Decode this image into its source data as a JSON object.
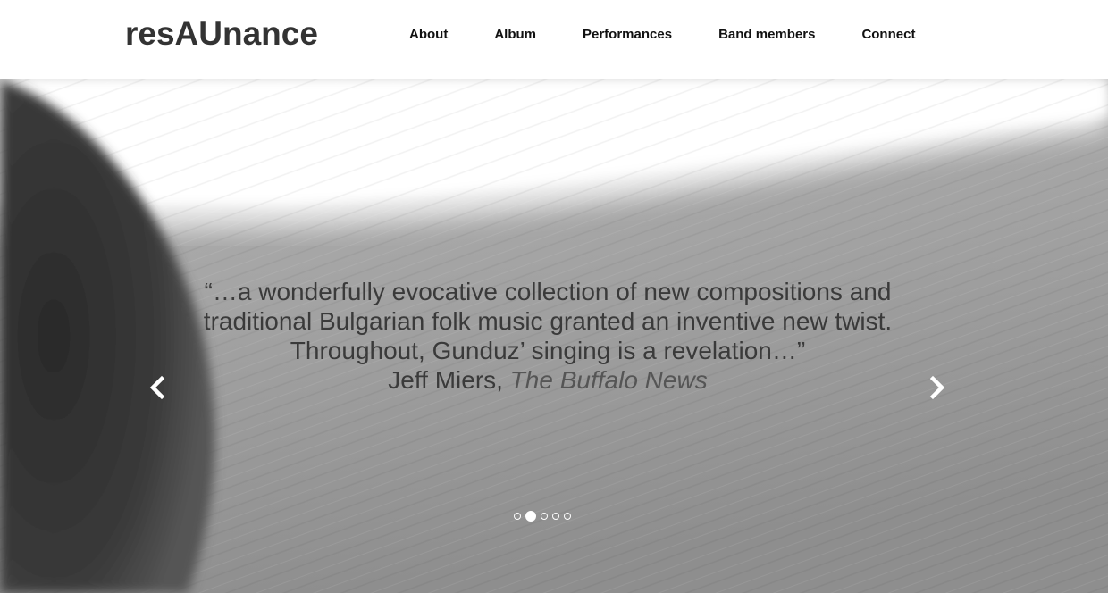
{
  "site": {
    "logo": "resAUnance"
  },
  "nav": {
    "items": [
      "About",
      "Album",
      "Performances",
      "Band members",
      "Connect"
    ]
  },
  "slide": {
    "quote_text": "“…a wonderfully evocative collection of new compositions and traditional Bulgarian folk music granted an inventive new twist. Throughout, Gunduz’ singing is a revelation…”",
    "author": "Jeff Miers, ",
    "publication": "The Buffalo News"
  },
  "carousel": {
    "prev_icon": "chevron-left-icon",
    "next_icon": "chevron-right-icon",
    "indicator_count": 5,
    "active_index": 1
  },
  "colors": {
    "text_dark": "#333333",
    "indicator": "#ffffff"
  }
}
